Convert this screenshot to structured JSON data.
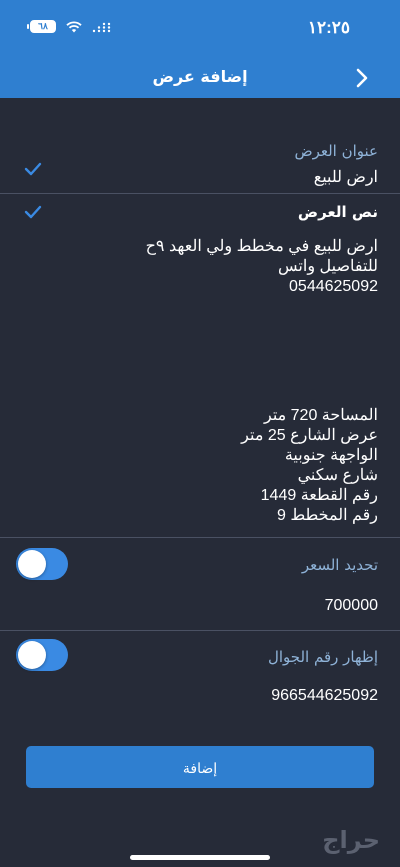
{
  "status_bar": {
    "time": "١٢:٢٥",
    "battery": "٦٨"
  },
  "header": {
    "title": "إضافة عرض"
  },
  "offer_title": {
    "label": "عنوان العرض",
    "value": "ارض للبيع"
  },
  "offer_text": {
    "label": "نص العرض",
    "body_top": "ارض للبيع في مخطط ولي العهد ٩ح\nللتفاصيل واتس\n0544625092",
    "body_bottom": "المساحة 720 متر\nعرض الشارع 25 متر\nالواجهة جنوبية\nشارع سكني\nرقم القطعة 1449\nرقم المخطط 9"
  },
  "price": {
    "label": "تحديد السعر",
    "value": "700000"
  },
  "phone": {
    "label": "إظهار رقم الجوال",
    "value": "966544625092"
  },
  "submit": {
    "label": "إضافة"
  },
  "watermark": "حراج",
  "colors": {
    "header": "#2f7fd0",
    "background": "#262b38",
    "toggle": "#3a8ae3"
  }
}
